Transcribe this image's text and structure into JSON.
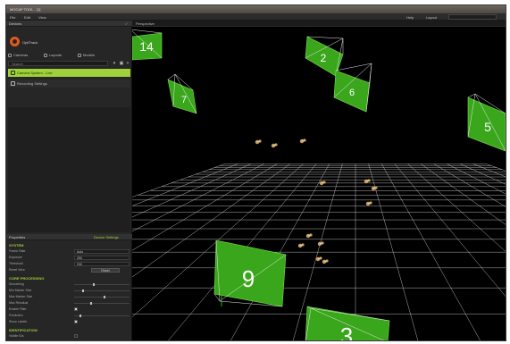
{
  "window": {
    "title": "MOCAP TOOL - [1]",
    "menus": [
      "File",
      "Edit",
      "View"
    ],
    "right_menus": [
      "Help",
      "Layout"
    ]
  },
  "sidebar": {
    "panel_title": "Devices",
    "app_name": "OptiTrack",
    "tabs": [
      {
        "label": "Cameras",
        "icon": "camera-icon"
      },
      {
        "label": "Layouts",
        "icon": "layout-icon"
      },
      {
        "label": "Models",
        "icon": "model-icon"
      }
    ],
    "search_placeholder": "Search",
    "items": [
      {
        "label": "Camera System - Live",
        "selected": true
      },
      {
        "label": "Recording Settings",
        "selected": false
      }
    ]
  },
  "properties": {
    "header": "Properties",
    "header_right": "Device Settings",
    "sections": [
      {
        "title": "SYSTEM",
        "rows": [
          {
            "label": "Frame Rate",
            "kind": "value",
            "value": "Auto"
          },
          {
            "label": "Exposure",
            "kind": "value",
            "value": "250"
          },
          {
            "label": "Threshold",
            "kind": "value",
            "value": "200"
          },
          {
            "label": "Reset View",
            "kind": "button",
            "value": "Reset"
          }
        ]
      },
      {
        "title": "CORE PROCESSING",
        "rows": [
          {
            "label": "Smoothing",
            "kind": "slider",
            "value": 0.35
          },
          {
            "label": "Min Marker Size",
            "kind": "slider",
            "value": 0.15
          },
          {
            "label": "Max Marker Size",
            "kind": "slider",
            "value": 0.55
          },
          {
            "label": "Max Residual",
            "kind": "slider",
            "value": 0.3
          },
          {
            "label": "Enable Filter",
            "kind": "check",
            "value": true
          },
          {
            "label": "Prediction",
            "kind": "slider",
            "value": 0.1
          },
          {
            "label": "Show Labels",
            "kind": "check",
            "value": true
          }
        ]
      },
      {
        "title": "IDENTIFICATION",
        "rows": [
          {
            "label": "Visible IDs",
            "kind": "check",
            "value": false
          }
        ]
      }
    ]
  },
  "viewport": {
    "title": "Perspective",
    "camera_labels": [
      "14",
      "2",
      "7",
      "6",
      "5",
      "9",
      "3"
    ],
    "colors": {
      "camera": "#3aa61c",
      "grid": "#d0d0d0",
      "marker": "#c9a060",
      "background": "#000000"
    }
  }
}
